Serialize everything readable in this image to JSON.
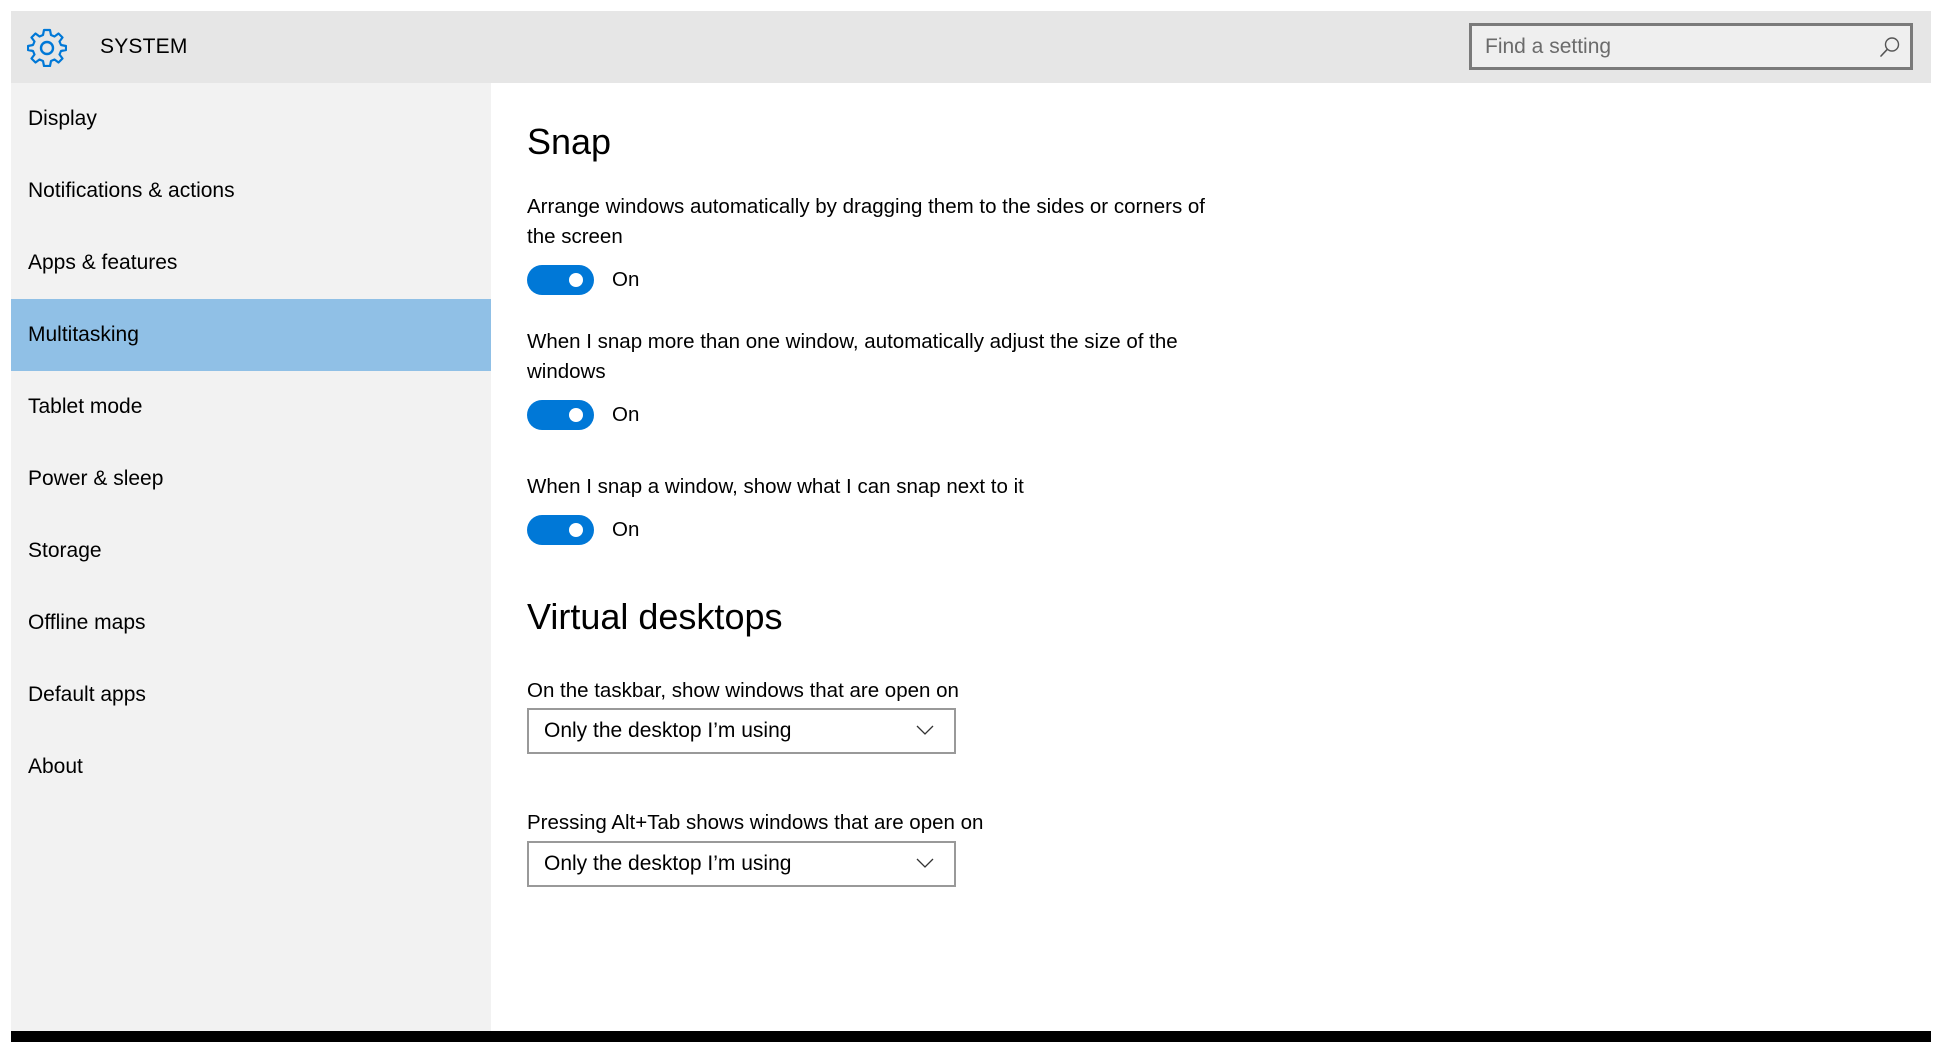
{
  "header": {
    "app_icon": "gear-icon",
    "title": "SYSTEM",
    "search": {
      "placeholder": "Find a setting",
      "value": "",
      "icon": "search-icon"
    }
  },
  "sidebar": {
    "items": [
      {
        "label": "Display",
        "active": false
      },
      {
        "label": "Notifications & actions",
        "active": false
      },
      {
        "label": "Apps & features",
        "active": false
      },
      {
        "label": "Multitasking",
        "active": true
      },
      {
        "label": "Tablet mode",
        "active": false
      },
      {
        "label": "Power & sleep",
        "active": false
      },
      {
        "label": "Storage",
        "active": false
      },
      {
        "label": "Offline maps",
        "active": false
      },
      {
        "label": "Default apps",
        "active": false
      },
      {
        "label": "About",
        "active": false
      }
    ]
  },
  "main": {
    "snap": {
      "heading": "Snap",
      "settings": [
        {
          "description": "Arrange windows automatically by dragging them to the sides or corners of the screen",
          "state": "On",
          "enabled": true
        },
        {
          "description": "When I snap more than one window, automatically adjust the size of the windows",
          "state": "On",
          "enabled": true
        },
        {
          "description": "When I snap a window, show what I can snap next to it",
          "state": "On",
          "enabled": true
        }
      ]
    },
    "virtual_desktops": {
      "heading": "Virtual desktops",
      "settings": [
        {
          "label": "On the taskbar, show windows that are open on",
          "selected": "Only the desktop I’m using"
        },
        {
          "label": "Pressing Alt+Tab shows windows that are open on",
          "selected": "Only the desktop I’m using"
        }
      ]
    }
  },
  "colors": {
    "accent": "#0078d7",
    "selected_nav": "#90c0e6",
    "header_bg": "#e6e6e6",
    "sidebar_bg": "#f2f2f2"
  }
}
